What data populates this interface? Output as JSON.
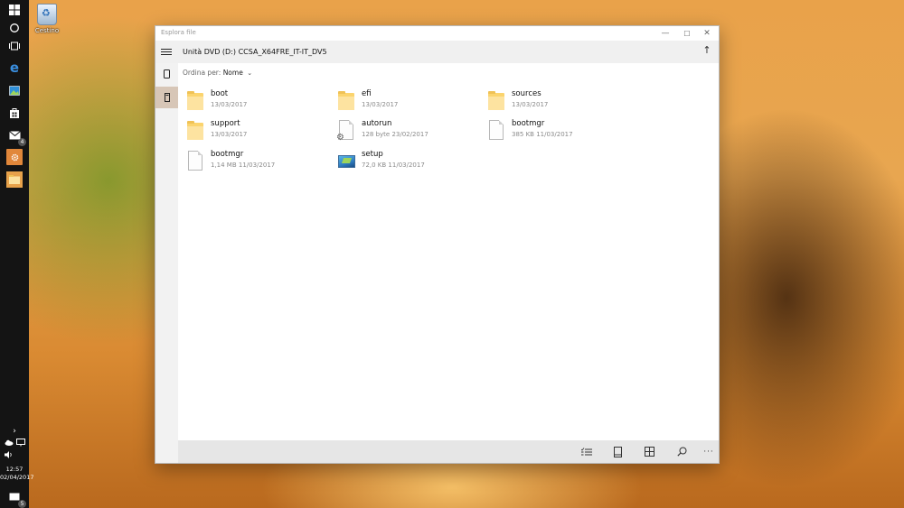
{
  "desktop": {
    "recycle_bin_label": "Cestino"
  },
  "taskbar": {
    "items": [
      "start",
      "search",
      "task-view",
      "edge",
      "photos",
      "store",
      "mail",
      "file-explorer",
      "explorer"
    ],
    "mail_badge": "4",
    "chevron": "›",
    "clock": {
      "time": "12:57",
      "date": "02/04/2017"
    },
    "notifications_badge": "5"
  },
  "window": {
    "app_title": "Esplora file",
    "path_title": "Unità DVD (D:) CCSA_X64FRE_IT-IT_DV5",
    "sort": {
      "label": "Ordina per:",
      "value": "Nome"
    },
    "controls": {
      "minimize": "—",
      "maximize": "☐",
      "close": "✕"
    },
    "up_glyph": "↑",
    "files": [
      {
        "name": "boot",
        "meta": "13/03/2017",
        "icon": "folder"
      },
      {
        "name": "efi",
        "meta": "13/03/2017",
        "icon": "folder"
      },
      {
        "name": "sources",
        "meta": "13/03/2017",
        "icon": "folder"
      },
      {
        "name": "support",
        "meta": "13/03/2017",
        "icon": "folder"
      },
      {
        "name": "autorun",
        "meta": "128 byte  23/02/2017",
        "icon": "settings-file"
      },
      {
        "name": "bootmgr",
        "meta": "385 KB  11/03/2017",
        "icon": "file"
      },
      {
        "name": "bootmgr",
        "meta": "1,14 MB  11/03/2017",
        "icon": "file"
      },
      {
        "name": "setup",
        "meta": "72,0 KB  11/03/2017",
        "icon": "setup-app"
      }
    ],
    "commands": {
      "select": "☰",
      "pane": "▯",
      "view": "⊞",
      "search": "⌕",
      "more": "···"
    }
  },
  "colors": {
    "taskbar": "#141414",
    "accent": "#e1873a",
    "folder": "#fbd46e",
    "nav_selected": "#d7c6b7",
    "command_bar": "#e6e6e6"
  }
}
